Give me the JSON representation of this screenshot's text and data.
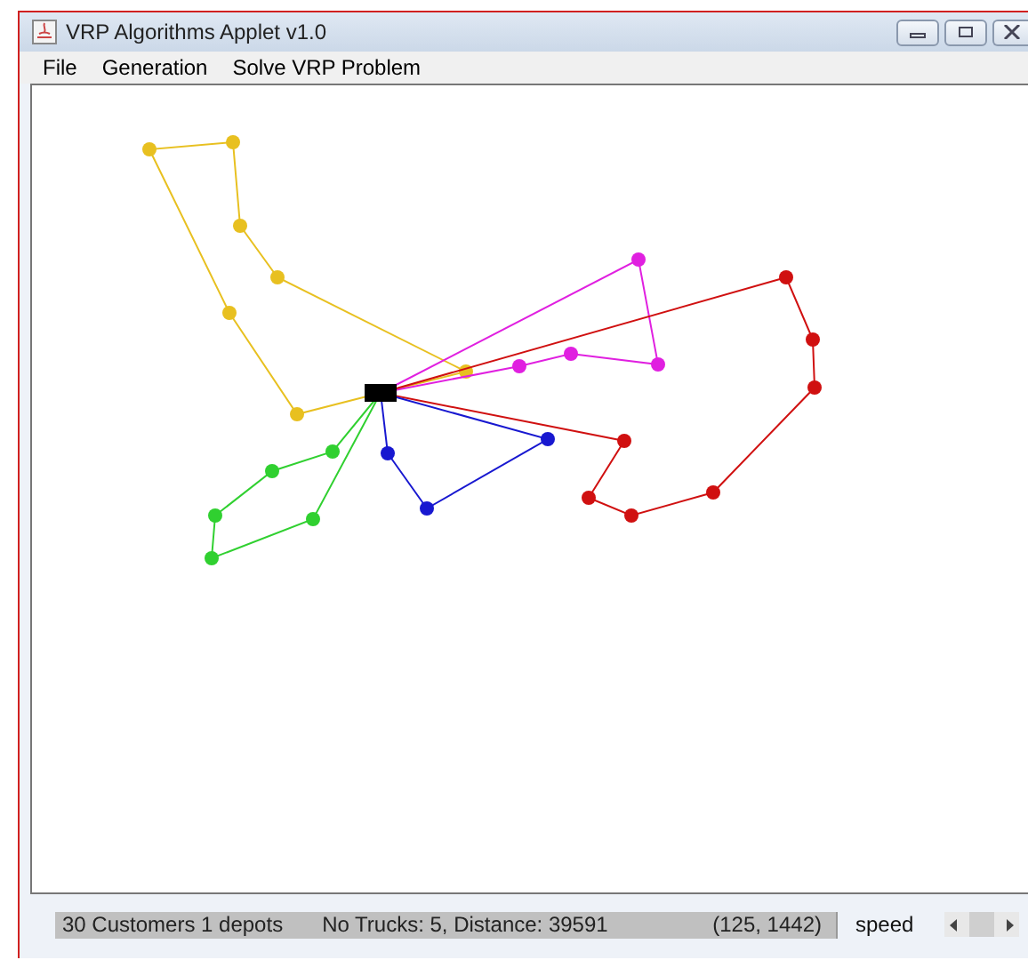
{
  "window": {
    "title": "VRP Algorithms Applet v1.0"
  },
  "menu": [
    "File",
    "Generation",
    "Solve VRP Problem"
  ],
  "routes": [
    {
      "color": "#e8c020"
    },
    {
      "color": "#e020e0"
    },
    {
      "color": "#d01010"
    },
    {
      "color": "#1818d0"
    },
    {
      "color": "#30d030"
    }
  ],
  "status_bar": {
    "customers": "30 Customers 1 depots",
    "trucks": "No Trucks: 5, Distance: 39591",
    "coords": "(125,  1442)",
    "speed_label": "speed"
  }
}
